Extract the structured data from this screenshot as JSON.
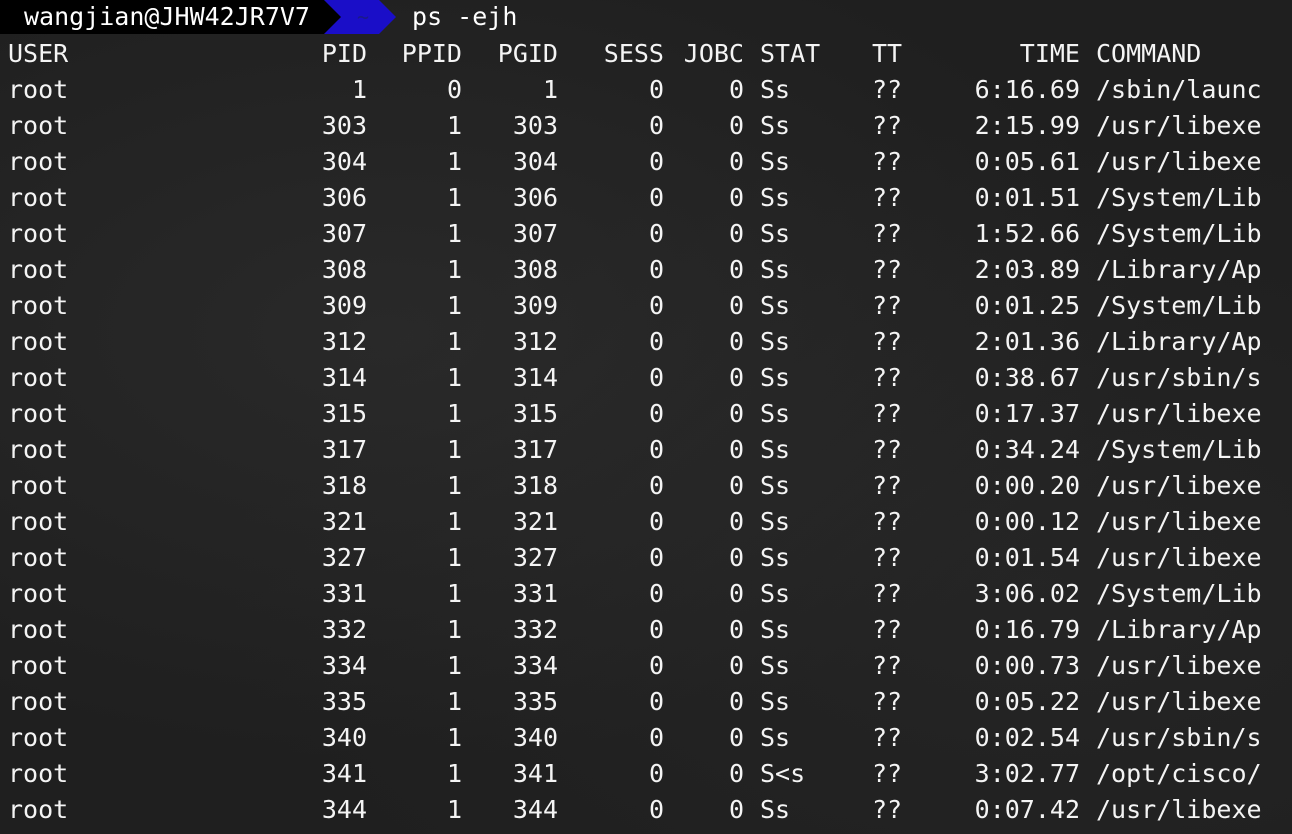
{
  "prompt": {
    "user_host": "wangjian@JHW42JR7V7",
    "directory": "~",
    "command": "ps -ejh"
  },
  "table": {
    "headers": {
      "user": "USER",
      "pid": "PID",
      "ppid": "PPID",
      "pgid": "PGID",
      "sess": "SESS",
      "jobc": "JOBC",
      "stat": "STAT",
      "tt": "TT",
      "time": "TIME",
      "command": "COMMAND"
    },
    "rows": [
      {
        "user": "root",
        "pid": "1",
        "ppid": "0",
        "pgid": "1",
        "sess": "0",
        "jobc": "0",
        "stat": "Ss",
        "tt": "??",
        "time": "6:16.69",
        "command": "/sbin/launc"
      },
      {
        "user": "root",
        "pid": "303",
        "ppid": "1",
        "pgid": "303",
        "sess": "0",
        "jobc": "0",
        "stat": "Ss",
        "tt": "??",
        "time": "2:15.99",
        "command": "/usr/libexe"
      },
      {
        "user": "root",
        "pid": "304",
        "ppid": "1",
        "pgid": "304",
        "sess": "0",
        "jobc": "0",
        "stat": "Ss",
        "tt": "??",
        "time": "0:05.61",
        "command": "/usr/libexe"
      },
      {
        "user": "root",
        "pid": "306",
        "ppid": "1",
        "pgid": "306",
        "sess": "0",
        "jobc": "0",
        "stat": "Ss",
        "tt": "??",
        "time": "0:01.51",
        "command": "/System/Lib"
      },
      {
        "user": "root",
        "pid": "307",
        "ppid": "1",
        "pgid": "307",
        "sess": "0",
        "jobc": "0",
        "stat": "Ss",
        "tt": "??",
        "time": "1:52.66",
        "command": "/System/Lib"
      },
      {
        "user": "root",
        "pid": "308",
        "ppid": "1",
        "pgid": "308",
        "sess": "0",
        "jobc": "0",
        "stat": "Ss",
        "tt": "??",
        "time": "2:03.89",
        "command": "/Library/Ap"
      },
      {
        "user": "root",
        "pid": "309",
        "ppid": "1",
        "pgid": "309",
        "sess": "0",
        "jobc": "0",
        "stat": "Ss",
        "tt": "??",
        "time": "0:01.25",
        "command": "/System/Lib"
      },
      {
        "user": "root",
        "pid": "312",
        "ppid": "1",
        "pgid": "312",
        "sess": "0",
        "jobc": "0",
        "stat": "Ss",
        "tt": "??",
        "time": "2:01.36",
        "command": "/Library/Ap"
      },
      {
        "user": "root",
        "pid": "314",
        "ppid": "1",
        "pgid": "314",
        "sess": "0",
        "jobc": "0",
        "stat": "Ss",
        "tt": "??",
        "time": "0:38.67",
        "command": "/usr/sbin/s"
      },
      {
        "user": "root",
        "pid": "315",
        "ppid": "1",
        "pgid": "315",
        "sess": "0",
        "jobc": "0",
        "stat": "Ss",
        "tt": "??",
        "time": "0:17.37",
        "command": "/usr/libexe"
      },
      {
        "user": "root",
        "pid": "317",
        "ppid": "1",
        "pgid": "317",
        "sess": "0",
        "jobc": "0",
        "stat": "Ss",
        "tt": "??",
        "time": "0:34.24",
        "command": "/System/Lib"
      },
      {
        "user": "root",
        "pid": "318",
        "ppid": "1",
        "pgid": "318",
        "sess": "0",
        "jobc": "0",
        "stat": "Ss",
        "tt": "??",
        "time": "0:00.20",
        "command": "/usr/libexe"
      },
      {
        "user": "root",
        "pid": "321",
        "ppid": "1",
        "pgid": "321",
        "sess": "0",
        "jobc": "0",
        "stat": "Ss",
        "tt": "??",
        "time": "0:00.12",
        "command": "/usr/libexe"
      },
      {
        "user": "root",
        "pid": "327",
        "ppid": "1",
        "pgid": "327",
        "sess": "0",
        "jobc": "0",
        "stat": "Ss",
        "tt": "??",
        "time": "0:01.54",
        "command": "/usr/libexe"
      },
      {
        "user": "root",
        "pid": "331",
        "ppid": "1",
        "pgid": "331",
        "sess": "0",
        "jobc": "0",
        "stat": "Ss",
        "tt": "??",
        "time": "3:06.02",
        "command": "/System/Lib"
      },
      {
        "user": "root",
        "pid": "332",
        "ppid": "1",
        "pgid": "332",
        "sess": "0",
        "jobc": "0",
        "stat": "Ss",
        "tt": "??",
        "time": "0:16.79",
        "command": "/Library/Ap"
      },
      {
        "user": "root",
        "pid": "334",
        "ppid": "1",
        "pgid": "334",
        "sess": "0",
        "jobc": "0",
        "stat": "Ss",
        "tt": "??",
        "time": "0:00.73",
        "command": "/usr/libexe"
      },
      {
        "user": "root",
        "pid": "335",
        "ppid": "1",
        "pgid": "335",
        "sess": "0",
        "jobc": "0",
        "stat": "Ss",
        "tt": "??",
        "time": "0:05.22",
        "command": "/usr/libexe"
      },
      {
        "user": "root",
        "pid": "340",
        "ppid": "1",
        "pgid": "340",
        "sess": "0",
        "jobc": "0",
        "stat": "Ss",
        "tt": "??",
        "time": "0:02.54",
        "command": "/usr/sbin/s"
      },
      {
        "user": "root",
        "pid": "341",
        "ppid": "1",
        "pgid": "341",
        "sess": "0",
        "jobc": "0",
        "stat": "S<s",
        "tt": "??",
        "time": "3:02.77",
        "command": "/opt/cisco/"
      },
      {
        "user": "root",
        "pid": "344",
        "ppid": "1",
        "pgid": "344",
        "sess": "0",
        "jobc": "0",
        "stat": "Ss",
        "tt": "??",
        "time": "0:07.42",
        "command": "/usr/libexe"
      }
    ]
  },
  "colors": {
    "background": "#1f1f1f",
    "text": "#f4f4f4",
    "prompt_user_bg": "#000000",
    "prompt_dir_bg": "#1a0ec8"
  }
}
